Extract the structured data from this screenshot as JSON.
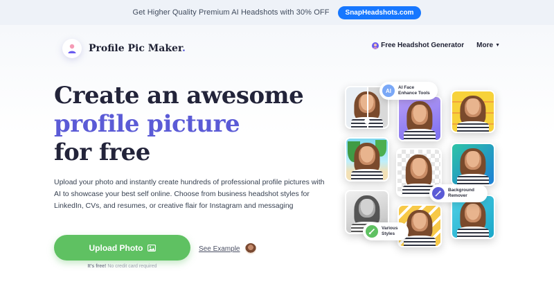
{
  "promo": {
    "text": "Get Higher Quality Premium AI Headshots with 30% OFF",
    "button": "SnapHeadshots.com"
  },
  "brand": {
    "name": "Profile Pic Maker",
    "dot": "."
  },
  "nav": {
    "items": [
      {
        "label": "Free Headshot Generator",
        "icon": "avatar-icon"
      },
      {
        "label": "More",
        "icon": "caret-down-icon"
      }
    ]
  },
  "hero": {
    "line1": "Create an awesome",
    "line2": "profile picture",
    "line3": "for free",
    "description": "Upload your photo and instantly create hundreds of professional profile pictures with AI to showcase your best self online. Choose from business headshot styles for LinkedIn, CVs, and resumes, or creative flair for Instagram and messaging",
    "upload_label": "Upload Photo",
    "see_example": "See Example",
    "free_strong": "It's free!",
    "free_rest": " No credit card required"
  },
  "badges": [
    {
      "label": "AI Face Enhance Tools",
      "icon": "AI"
    },
    {
      "label": "Background Remover",
      "icon": "wand"
    },
    {
      "label": "Various Styles",
      "icon": "brush"
    }
  ],
  "colors": {
    "accent": "#5b5bd6",
    "cta": "#5fc162",
    "promo_button": "#1677ff"
  }
}
